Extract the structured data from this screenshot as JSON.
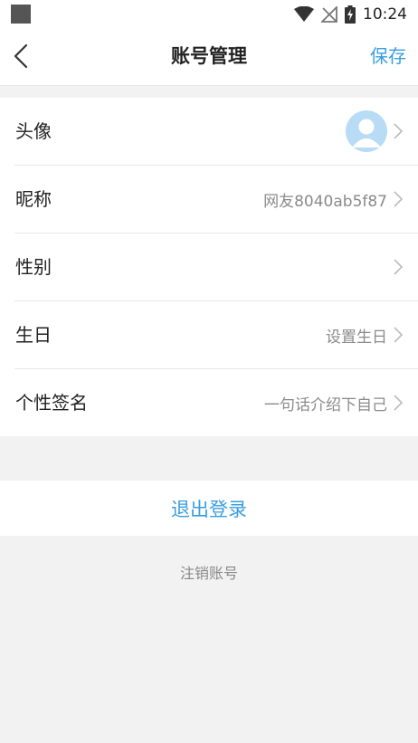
{
  "status_bar": {
    "time": "10:24"
  },
  "header": {
    "title": "账号管理",
    "save_label": "保存"
  },
  "rows": [
    {
      "label": "头像",
      "value": ""
    },
    {
      "label": "昵称",
      "value": "网友8040ab5f87"
    },
    {
      "label": "性别",
      "value": ""
    },
    {
      "label": "生日",
      "value": "设置生日"
    },
    {
      "label": "个性签名",
      "value": "一句话介绍下自己"
    }
  ],
  "actions": {
    "logout_label": "退出登录",
    "deactivate_label": "注销账号"
  },
  "colors": {
    "accent": "#3a9ee0",
    "avatar_bg": "#b8dcf6"
  }
}
